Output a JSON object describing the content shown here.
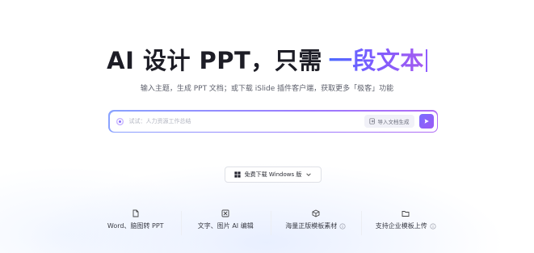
{
  "hero": {
    "title_plain": "AI 设计 PPT，只需",
    "title_highlight": "一段文本",
    "subtitle": "输入主题，生成 PPT 文档；或下载 iSlide 插件客户端，获取更多「极客」功能"
  },
  "search": {
    "placeholder": "试试：人力资源工作总结",
    "value": "",
    "import_label": "导入文档生成"
  },
  "download": {
    "label": "免费下载 Windows 版"
  },
  "features": [
    {
      "icon": "document-icon",
      "label": "Word、脑图转 PPT",
      "info": false
    },
    {
      "icon": "image-icon",
      "label": "文字、图片 AI 编辑",
      "info": false
    },
    {
      "icon": "cube-icon",
      "label": "海量正版模板素材",
      "info": true
    },
    {
      "icon": "folder-icon",
      "label": "支持企业模板上传",
      "info": true
    }
  ],
  "colors": {
    "accent_start": "#4d6bff",
    "accent_end": "#a45bf0",
    "send_button": "#8562f7"
  }
}
